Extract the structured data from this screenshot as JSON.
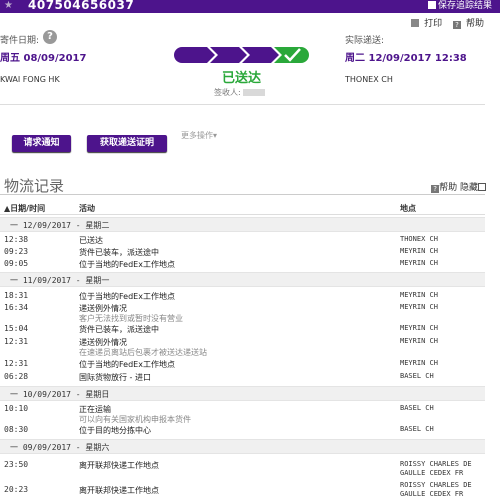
{
  "header": {
    "tracking_number": "407504656037",
    "save_label": "保存追踪结果"
  },
  "links": {
    "print": "打印",
    "help": "帮助"
  },
  "shipment": {
    "ship_label": "寄件日期:",
    "ship_date": "周五 08/09/2017",
    "origin": "KWAI FONG HK",
    "actual_label": "实际递送:",
    "actual_date": "周二 12/09/2017 12:38",
    "destination": "THONEX CH",
    "status": "已送达",
    "signed_by_label": "签收人:"
  },
  "actions": {
    "request_notice": "请求通知",
    "obtain_proof": "获取递送证明",
    "more_actions": "更多操作▾"
  },
  "travel_history": {
    "title": "物流记录",
    "help": "帮助",
    "hide": "隐藏",
    "col_datetime": "▲日期/时间",
    "col_activity": "活动",
    "col_location": "地点",
    "days": [
      {
        "label": "一  12/09/2017 - 星期二"
      },
      {
        "label": "一  11/09/2017 - 星期一"
      },
      {
        "label": "一  10/09/2017 - 星期日"
      },
      {
        "label": "一  09/09/2017 - 星期六"
      }
    ],
    "events": [
      {
        "time": "12:38",
        "activity": "已送达",
        "sub": "",
        "location": "THONEX CH"
      },
      {
        "time": "09:23",
        "activity": "货件已装车，派送途中",
        "sub": "",
        "location": "MEYRIN CH"
      },
      {
        "time": "09:05",
        "activity": "位于当地的FedEx工作地点",
        "sub": "",
        "location": "MEYRIN CH"
      },
      {
        "time": "18:31",
        "activity": "位于当地的FedEx工作地点",
        "sub": "",
        "location": "MEYRIN CH"
      },
      {
        "time": "16:34",
        "activity": "递送例外情况",
        "sub": "客户无法找到或暂时没有营业",
        "location": "MEYRIN CH"
      },
      {
        "time": "15:04",
        "activity": "货件已装车，派送途中",
        "sub": "",
        "location": "MEYRIN CH"
      },
      {
        "time": "12:31",
        "activity": "递送例外情况",
        "sub": "在速递员离站后包裹才被送达递送站",
        "location": "MEYRIN CH"
      },
      {
        "time": "12:31",
        "activity": "位于当地的FedEx工作地点",
        "sub": "",
        "location": "MEYRIN CH"
      },
      {
        "time": "06:28",
        "activity": "国际货物放行 - 进口",
        "sub": "",
        "location": "BASEL CH"
      },
      {
        "time": "10:10",
        "activity": "正在运输",
        "sub": "可以向有关国家机构申报本货件",
        "location": "BASEL CH"
      },
      {
        "time": "08:30",
        "activity": "位于目的地分拣中心",
        "sub": "",
        "location": "BASEL CH"
      },
      {
        "time": "23:50",
        "activity": "离开联邦快递工作地点",
        "sub": "",
        "location": "ROISSY CHARLES DE GAULLE CEDEX FR"
      },
      {
        "time": "20:23",
        "activity": "离开联邦快递工作地点",
        "sub": "",
        "location": "ROISSY CHARLES DE GAULLE CEDEX FR"
      }
    ]
  }
}
